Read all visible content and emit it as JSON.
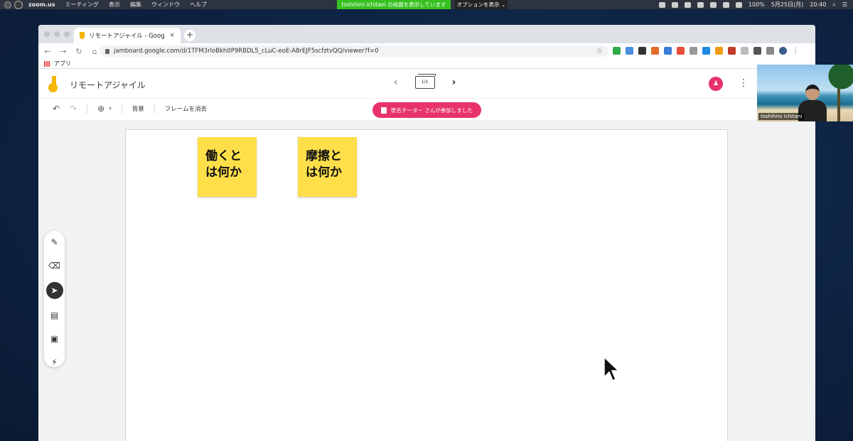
{
  "menubar": {
    "app_name": "zoom.us",
    "menus": [
      "ミーティング",
      "表示",
      "編集",
      "ウィンドウ",
      "ヘルプ"
    ],
    "share_banner": "toshihiro  ichitani の画面を表示しています",
    "options_label": "オプションを表示",
    "battery": "100%",
    "date": "5月25日(月)",
    "time": "20:40"
  },
  "browser": {
    "tab_title": "リモートアジャイル - Google Jam",
    "url": "jamboard.google.com/d/1TFM3rloBkh0P9RBDL5_cLuC-eoE-A8rEJF5scfztvQQ/viewer?f=0",
    "bookmark_apps": "アプリ"
  },
  "jamboard": {
    "title": "リモートアジャイル",
    "frame_counter": "1/1",
    "toolbar": {
      "background_label": "背景",
      "clear_frame_label": "フレームを消去"
    },
    "toast": "匿名チーター さんが参加しました",
    "stickies": [
      {
        "text": "働くとは何か"
      },
      {
        "text": "摩擦とは何か"
      }
    ],
    "colors": {
      "sticky_yellow": "#fedf4a",
      "toast_pink": "#e8336a",
      "logo_yellow": "#f7b500"
    }
  },
  "camera": {
    "participant_name": "toshihiro  ichitani"
  }
}
